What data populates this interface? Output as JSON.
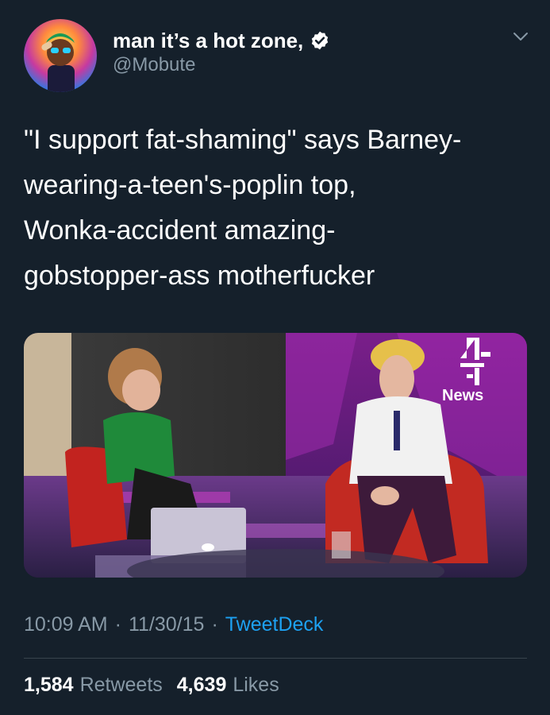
{
  "tweet": {
    "author": {
      "display_name": "man it’s a hot zone,",
      "handle": "@Mobute",
      "verified": true,
      "avatar_icon": "profile-avatar"
    },
    "text": "\"I support fat-shaming\" says Barney-\nwearing-a-teen's-poplin top,\nWonka-accident amazing-\ngobstopper-ass motherfucker",
    "media": {
      "type": "video-still",
      "channel_logo_text": "News"
    },
    "time": "10:09 AM",
    "date": "11/30/15",
    "separator": "·",
    "source": "TweetDeck",
    "stats": {
      "retweets_count": "1,584",
      "retweets_label": "Retweets",
      "likes_count": "4,639",
      "likes_label": "Likes"
    }
  },
  "colors": {
    "background": "#15202b",
    "text": "#ffffff",
    "secondary_text": "#8899a6",
    "link": "#1da1f2",
    "verified": "#ffffff",
    "divider": "#38444d"
  },
  "icons": {
    "verified": "verified-badge-icon",
    "more": "chevron-down-icon"
  }
}
